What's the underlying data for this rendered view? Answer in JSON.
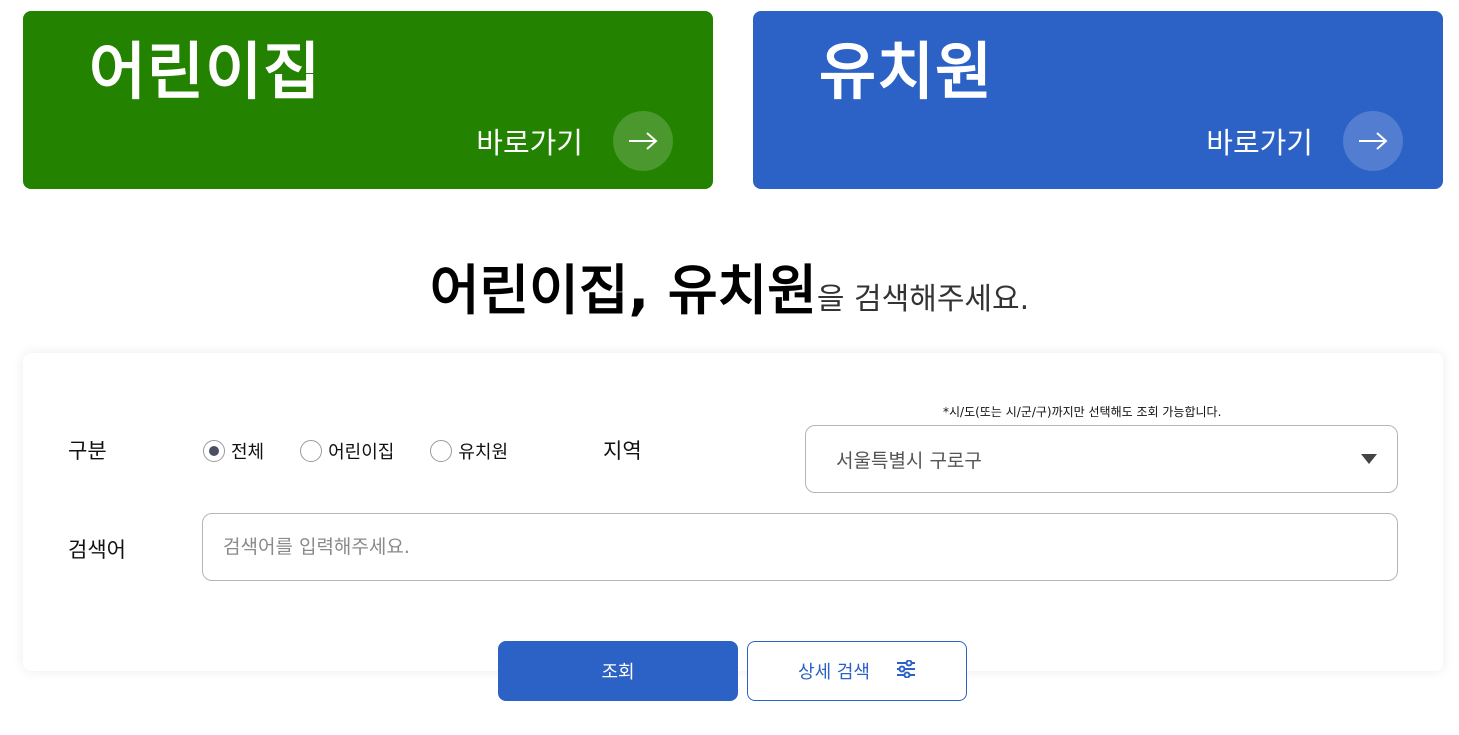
{
  "cards": {
    "daycare": {
      "title": "어린이집",
      "go_label": "바로가기",
      "color": "#238200"
    },
    "kindergarten": {
      "title": "유치원",
      "go_label": "바로가기",
      "color": "#2c61c6"
    }
  },
  "headline": {
    "strong": "어린이집, 유치원",
    "light": "을 검색해주세요."
  },
  "form": {
    "type_label": "구분",
    "type_options": [
      {
        "label": "전체",
        "selected": true
      },
      {
        "label": "어린이집",
        "selected": false
      },
      {
        "label": "유치원",
        "selected": false
      }
    ],
    "region_label": "지역",
    "region_note": "*시/도(또는 시/군/구)까지만 선택해도 조회 가능합니다.",
    "region_value": "서울특별시 구로구",
    "keyword_label": "검색어",
    "keyword_placeholder": "검색어를 입력해주세요.",
    "keyword_value": ""
  },
  "buttons": {
    "search": "조회",
    "advanced": "상세 검색"
  }
}
